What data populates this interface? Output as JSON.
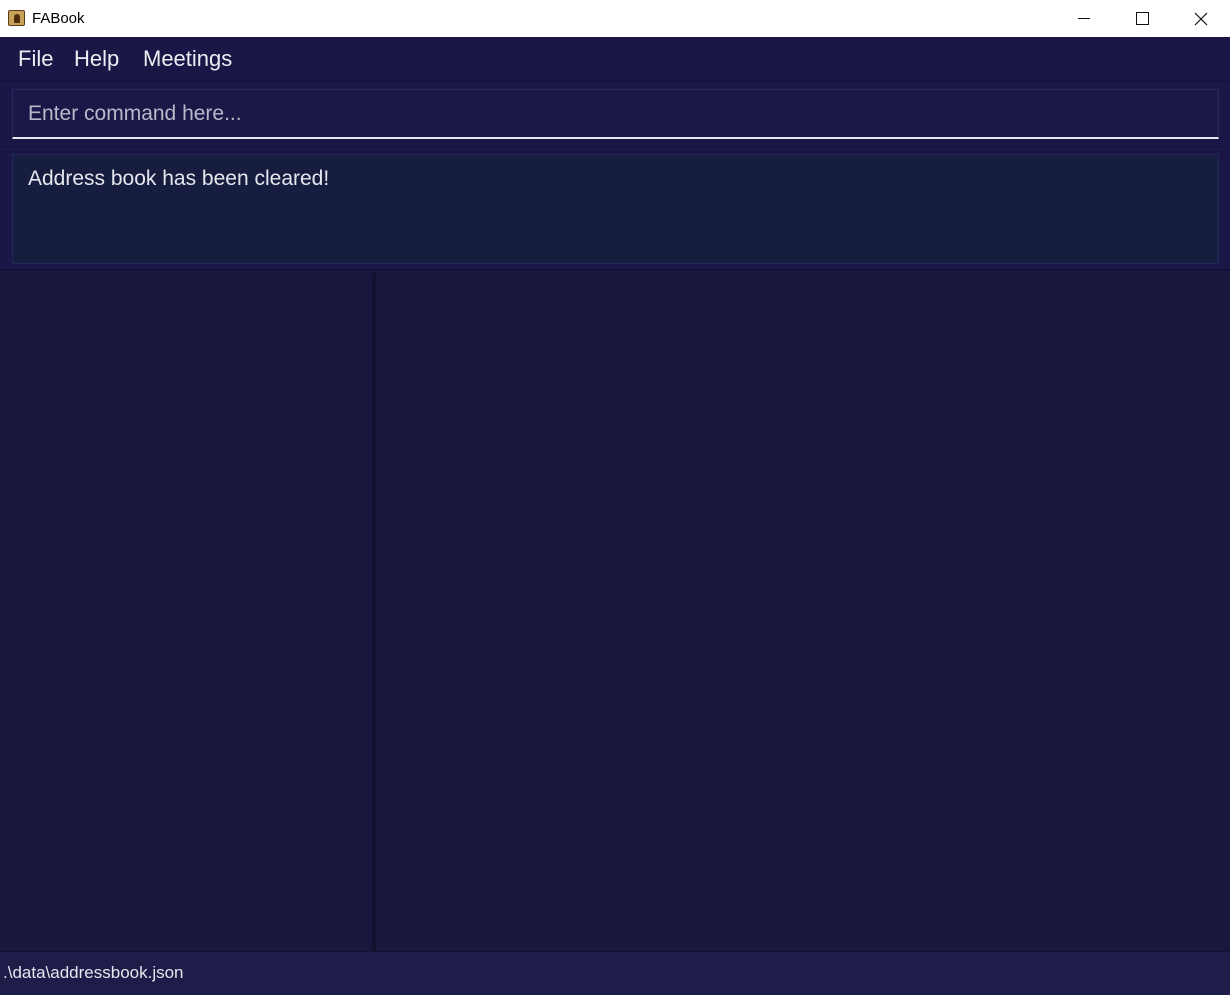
{
  "window": {
    "title": "FABook",
    "icon": "address-book-icon"
  },
  "menu": {
    "file": "File",
    "help": "Help",
    "meetings": "Meetings"
  },
  "command": {
    "placeholder": "Enter command here...",
    "value": ""
  },
  "result": {
    "message": "Address book has been cleared!"
  },
  "status": {
    "path": ".\\data\\addressbook.json"
  },
  "colors": {
    "background": "#18173e",
    "menubar": "#1a1747",
    "result_box": "#161d3e",
    "text": "#e6e6ee"
  }
}
